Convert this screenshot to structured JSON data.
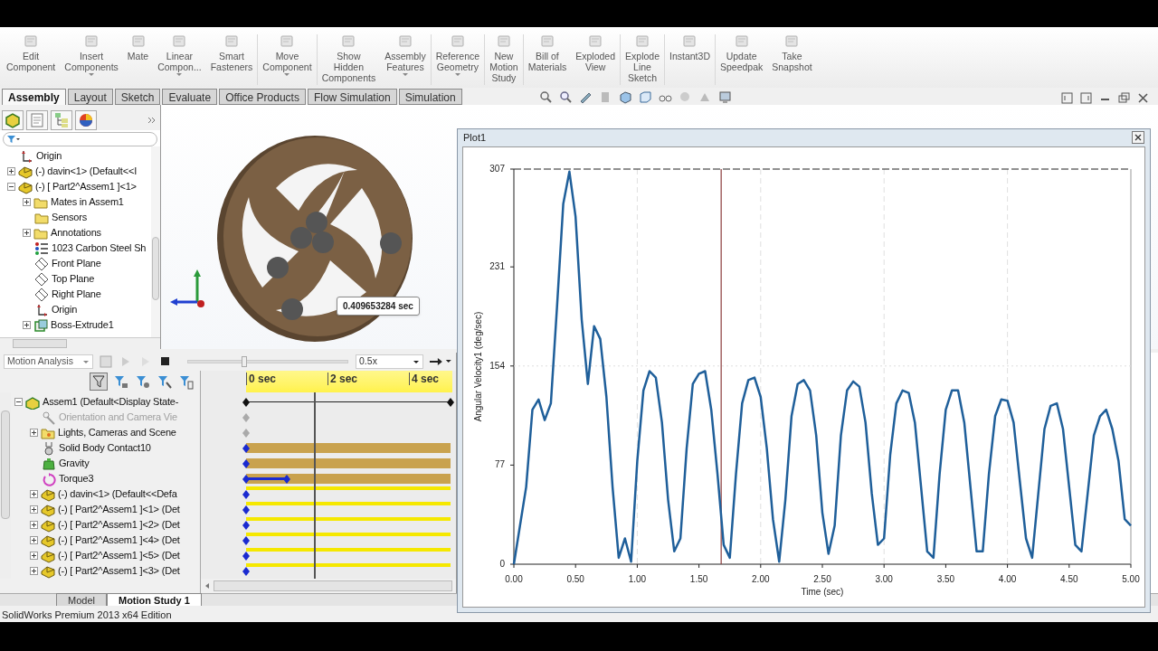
{
  "toolbar": [
    {
      "lines": [
        "Edit",
        "Component"
      ],
      "has_menu": false
    },
    {
      "lines": [
        "Insert",
        "Components"
      ],
      "has_menu": true
    },
    {
      "lines": [
        "Mate"
      ],
      "has_menu": false
    },
    {
      "lines": [
        "Linear",
        "Compon..."
      ],
      "has_menu": true
    },
    {
      "lines": [
        "Smart",
        "Fasteners"
      ],
      "has_menu": false
    },
    {
      "lines": [
        "Move",
        "Component"
      ],
      "has_menu": true
    },
    {
      "lines": [
        "Show",
        "Hidden",
        "Components"
      ],
      "has_menu": false
    },
    {
      "lines": [
        "Assembly",
        "Features"
      ],
      "has_menu": true
    },
    {
      "lines": [
        "Reference",
        "Geometry"
      ],
      "has_menu": true
    },
    {
      "lines": [
        "New",
        "Motion",
        "Study"
      ],
      "has_menu": false
    },
    {
      "lines": [
        "Bill of",
        "Materials"
      ],
      "has_menu": false
    },
    {
      "lines": [
        "Exploded",
        "View"
      ],
      "has_menu": false
    },
    {
      "lines": [
        "Explode",
        "Line",
        "Sketch"
      ],
      "has_menu": false
    },
    {
      "lines": [
        "Instant3D"
      ],
      "has_menu": false
    },
    {
      "lines": [
        "Update",
        "Speedpak"
      ],
      "has_menu": false
    },
    {
      "lines": [
        "Take",
        "Snapshot"
      ],
      "has_menu": false
    }
  ],
  "tabs": [
    {
      "label": "Assembly",
      "selected": true
    },
    {
      "label": "Layout",
      "selected": false
    },
    {
      "label": "Sketch",
      "selected": false
    },
    {
      "label": "Evaluate",
      "selected": false
    },
    {
      "label": "Office Products",
      "selected": false
    },
    {
      "label": "Flow Simulation",
      "selected": false
    },
    {
      "label": "Simulation",
      "selected": false
    }
  ],
  "feature_tree": {
    "items": [
      {
        "label": "Origin",
        "kind": "origin"
      },
      {
        "label": "(-) davin<1> (Default<<I",
        "kind": "part",
        "expanded": false
      },
      {
        "label": "(-) [ Part2^Assem1 ]<1>",
        "kind": "part",
        "expanded": true,
        "children": [
          {
            "label": "Mates in Assem1",
            "kind": "folder",
            "expanded": false
          },
          {
            "label": "Sensors",
            "kind": "folder"
          },
          {
            "label": "Annotations",
            "kind": "folder",
            "expanded": false
          },
          {
            "label": "1023 Carbon Steel Sh",
            "kind": "material"
          },
          {
            "label": "Front Plane",
            "kind": "plane"
          },
          {
            "label": "Top Plane",
            "kind": "plane"
          },
          {
            "label": "Right Plane",
            "kind": "plane"
          },
          {
            "label": "Origin",
            "kind": "origin"
          },
          {
            "label": "Boss-Extrude1",
            "kind": "feature",
            "expanded": false
          }
        ]
      }
    ]
  },
  "tooltip": "0.409653284 sec",
  "motion": {
    "study_type": "Motion Analysis",
    "speed": "0.5x",
    "playback_slider": {
      "level": 0.34
    },
    "time_bar": {
      "level": 0.33
    },
    "ruler": [
      "0 sec",
      "2 sec",
      "4 sec"
    ],
    "items": [
      {
        "label": "Assem1  (Default<Display State-",
        "kind": "assembly",
        "expanded": true,
        "track": {
          "kind": "span"
        },
        "children": [
          {
            "label": "Orientation and Camera Vie",
            "kind": "camera",
            "disabled": true,
            "track": {
              "kind": "key"
            }
          },
          {
            "label": "Lights, Cameras and Scene",
            "kind": "lights",
            "expanded": false,
            "disabled": false,
            "track": {
              "kind": "key"
            }
          },
          {
            "label": "Solid Body Contact10",
            "kind": "contact",
            "disabled": false,
            "track": {
              "kind": "bar"
            }
          },
          {
            "label": "Gravity",
            "kind": "gravity",
            "disabled": false,
            "track": {
              "kind": "bar"
            }
          },
          {
            "label": "Torque3",
            "kind": "torque",
            "disabled": false,
            "track": {
              "kind": "bar_keyed"
            }
          },
          {
            "label": "(-) davin<1> (Default<<Defa",
            "kind": "part",
            "expanded": false,
            "disabled": false,
            "track": {
              "kind": "line"
            }
          },
          {
            "label": "(-) [ Part2^Assem1 ]<1> (Det",
            "kind": "part",
            "expanded": false,
            "disabled": false,
            "track": {
              "kind": "line"
            }
          },
          {
            "label": "(-) [ Part2^Assem1 ]<2> (Det",
            "kind": "part",
            "expanded": false,
            "disabled": false,
            "track": {
              "kind": "line"
            }
          },
          {
            "label": "(-) [ Part2^Assem1 ]<4> (Det",
            "kind": "part",
            "expanded": false,
            "disabled": false,
            "track": {
              "kind": "line"
            }
          },
          {
            "label": "(-) [ Part2^Assem1 ]<5> (Det",
            "kind": "part",
            "expanded": false,
            "disabled": false,
            "track": {
              "kind": "line"
            }
          },
          {
            "label": "(-) [ Part2^Assem1 ]<3> (Det",
            "kind": "part",
            "expanded": false,
            "disabled": false,
            "track": {
              "kind": "line"
            }
          }
        ]
      }
    ]
  },
  "bottom_tabs": [
    {
      "label": "Model",
      "selected": false
    },
    {
      "label": "Motion Study 1",
      "selected": true
    }
  ],
  "status_bar": "SolidWorks Premium 2013 x64 Edition",
  "plot": {
    "title": "Plot1",
    "chart_data": {
      "type": "line",
      "xlabel": "Time (sec)",
      "ylabel": "Angular Velocity1 (deg/sec)",
      "xlim": [
        0,
        5
      ],
      "ylim": [
        0,
        307
      ],
      "xticks": [
        {
          "value": 0,
          "label": "0.00"
        },
        {
          "value": 0.5,
          "label": "0.50"
        },
        {
          "value": 1,
          "label": "1.00"
        },
        {
          "value": 1.5,
          "label": "1.50"
        },
        {
          "value": 2,
          "label": "2.00"
        },
        {
          "value": 2.5,
          "label": "2.50"
        },
        {
          "value": 3,
          "label": "3.00"
        },
        {
          "value": 3.5,
          "label": "3.50"
        },
        {
          "value": 4,
          "label": "4.00"
        },
        {
          "value": 4.5,
          "label": "4.50"
        },
        {
          "value": 5,
          "label": "5.00"
        }
      ],
      "yticks": [
        0,
        77,
        154,
        231,
        307
      ],
      "x": [
        0,
        0.05,
        0.1,
        0.15,
        0.2,
        0.25,
        0.3,
        0.35,
        0.4,
        0.45,
        0.5,
        0.55,
        0.6,
        0.65,
        0.7,
        0.75,
        0.8,
        0.85,
        0.9,
        0.95,
        1,
        1.05,
        1.1,
        1.15,
        1.2,
        1.25,
        1.3,
        1.35,
        1.4,
        1.45,
        1.5,
        1.55,
        1.6,
        1.65,
        1.7,
        1.75,
        1.8,
        1.85,
        1.9,
        1.95,
        2,
        2.05,
        2.1,
        2.15,
        2.2,
        2.25,
        2.3,
        2.35,
        2.4,
        2.45,
        2.5,
        2.55,
        2.6,
        2.65,
        2.7,
        2.75,
        2.8,
        2.85,
        2.9,
        2.95,
        3,
        3.05,
        3.1,
        3.15,
        3.2,
        3.25,
        3.3,
        3.35,
        3.4,
        3.45,
        3.5,
        3.55,
        3.6,
        3.65,
        3.7,
        3.75,
        3.8,
        3.85,
        3.9,
        3.95,
        4,
        4.05,
        4.1,
        4.15,
        4.2,
        4.25,
        4.3,
        4.35,
        4.4,
        4.45,
        4.5,
        4.55,
        4.6,
        4.65,
        4.7,
        4.75,
        4.8,
        4.85,
        4.9,
        4.95,
        5
      ],
      "series": [
        {
          "color": "#1f5f9a",
          "values": [
            0,
            30,
            60,
            120,
            128,
            112,
            125,
            200,
            280,
            305,
            270,
            190,
            140,
            185,
            175,
            130,
            60,
            5,
            20,
            2,
            80,
            135,
            150,
            145,
            110,
            50,
            10,
            20,
            90,
            140,
            148,
            150,
            120,
            70,
            15,
            5,
            70,
            125,
            143,
            145,
            130,
            90,
            35,
            2,
            50,
            115,
            140,
            143,
            135,
            100,
            40,
            8,
            30,
            100,
            135,
            142,
            138,
            110,
            55,
            15,
            20,
            85,
            125,
            135,
            133,
            110,
            60,
            10,
            5,
            70,
            120,
            135,
            135,
            110,
            60,
            10,
            10,
            70,
            115,
            128,
            127,
            110,
            65,
            20,
            5,
            55,
            105,
            123,
            125,
            105,
            60,
            15,
            10,
            55,
            100,
            115,
            120,
            105,
            80,
            35,
            30
          ]
        }
      ],
      "grid": true,
      "ref_lines": [
        {
          "axis": "x",
          "value": 1.68,
          "color": "#8b3a3a"
        },
        {
          "axis": "y",
          "value": 154,
          "color": "#dddddd"
        }
      ]
    }
  }
}
